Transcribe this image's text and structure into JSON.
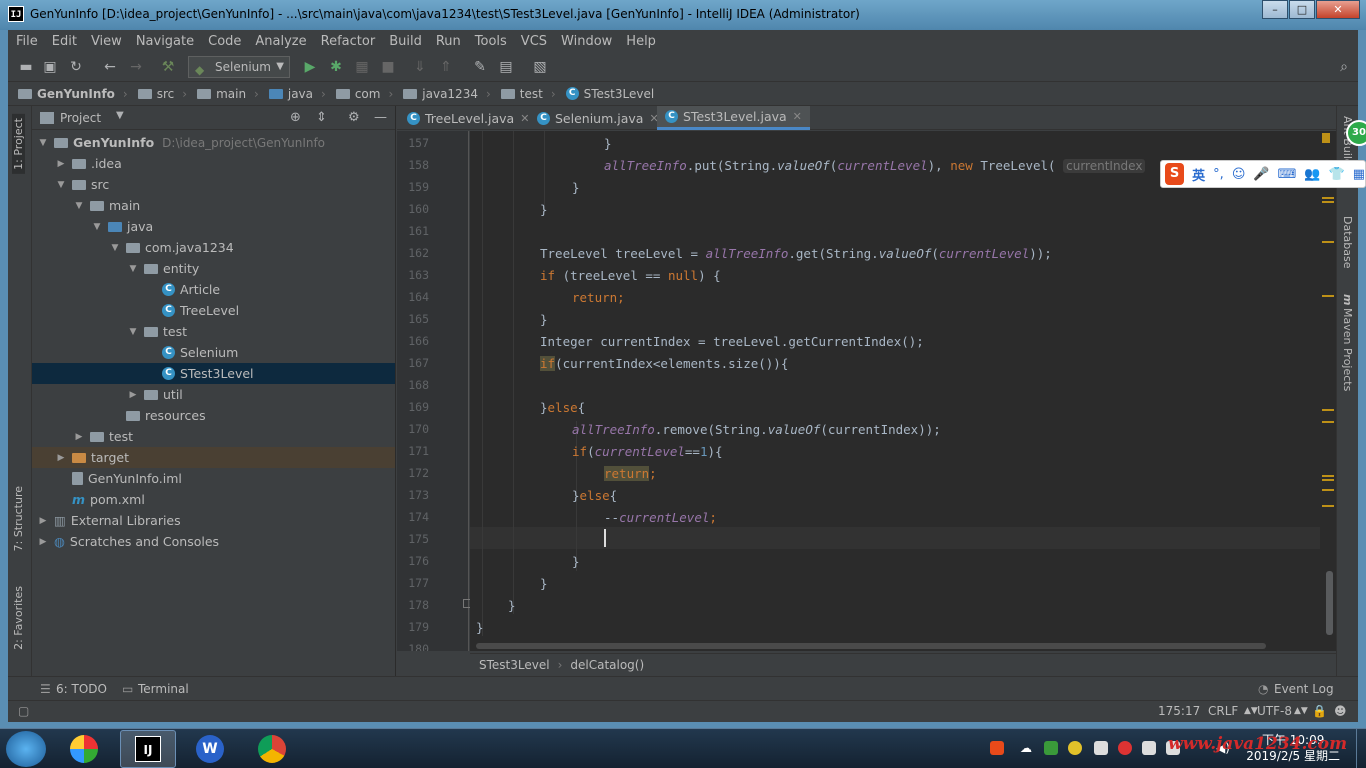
{
  "window": {
    "title": "GenYunInfo [D:\\idea_project\\GenYunInfo] - ...\\src\\main\\java\\com\\java1234\\test\\STest3Level.java [GenYunInfo] - IntelliJ IDEA (Administrator)",
    "app_icon": "IJ"
  },
  "menu": [
    "File",
    "Edit",
    "View",
    "Navigate",
    "Code",
    "Analyze",
    "Refactor",
    "Build",
    "Run",
    "Tools",
    "VCS",
    "Window",
    "Help"
  ],
  "toolbar": {
    "run_config": "Selenium"
  },
  "breadcrumbs": [
    "GenYunInfo",
    "src",
    "main",
    "java",
    "com",
    "java1234",
    "test",
    "STest3Level"
  ],
  "left_tabs": {
    "project": "1: Project",
    "structure": "7: Structure",
    "favorites": "2: Favorites"
  },
  "project_panel": {
    "title": "Project",
    "root": {
      "name": "GenYunInfo",
      "path": "D:\\idea_project\\GenYunInfo"
    },
    "tree": [
      {
        "label": ".idea"
      },
      {
        "label": "src"
      },
      {
        "label": "main"
      },
      {
        "label": "java"
      },
      {
        "label": "com.java1234"
      },
      {
        "label": "entity"
      },
      {
        "label": "Article"
      },
      {
        "label": "TreeLevel"
      },
      {
        "label": "test"
      },
      {
        "label": "Selenium"
      },
      {
        "label": "STest3Level"
      },
      {
        "label": "util"
      },
      {
        "label": "resources"
      },
      {
        "label": "test"
      },
      {
        "label": "target"
      },
      {
        "label": "GenYunInfo.iml"
      },
      {
        "label": "pom.xml"
      },
      {
        "label": "External Libraries"
      },
      {
        "label": "Scratches and Consoles"
      }
    ]
  },
  "editor": {
    "tabs": [
      "TreeLevel.java",
      "Selenium.java",
      "STest3Level.java"
    ],
    "active_tab": "STest3Level.java",
    "line_numbers": [
      "157",
      "158",
      "159",
      "160",
      "161",
      "162",
      "163",
      "164",
      "165",
      "166",
      "167",
      "168",
      "169",
      "170",
      "171",
      "172",
      "173",
      "174",
      "175",
      "176",
      "177",
      "178",
      "179",
      "180"
    ],
    "code": {
      "l157": "}",
      "l158_a": "allTreeInfo",
      "l158_b": ".put(String.",
      "l158_c": "valueOf",
      "l158_d": "(",
      "l158_e": "currentLevel",
      "l158_f": "), ",
      "l158_g": "new",
      "l158_h": " TreeLevel(",
      "l158_hint": "currentIndex",
      "l159": "}",
      "l160": "}",
      "l162_a": "TreeLevel treeLevel = ",
      "l162_b": "allTreeInfo",
      "l162_c": ".get(String.",
      "l162_d": "valueOf",
      "l162_e": "(",
      "l162_f": "currentLevel",
      "l162_g": "));",
      "l163_a": "if",
      "l163_b": " (treeLevel == ",
      "l163_c": "null",
      "l163_d": ") {",
      "l164": "return;",
      "l165": "}",
      "l166": "Integer currentIndex = treeLevel.getCurrentIndex();",
      "l167_a": "if",
      "l167_b": "(currentIndex<elements.size()){",
      "l169_a": "}",
      "l169_b": "else",
      "l169_c": "{",
      "l170_a": "allTreeInfo",
      "l170_b": ".remove(String.",
      "l170_c": "valueOf",
      "l170_d": "(currentIndex));",
      "l171_a": "if",
      "l171_b": "(",
      "l171_c": "currentLevel",
      "l171_d": "==",
      "l171_e": "1",
      "l171_f": "){",
      "l172_a": "return",
      "l172_b": ";",
      "l173_a": "}",
      "l173_b": "else",
      "l173_c": "{",
      "l174_a": "--",
      "l174_b": "currentLevel",
      "l174_c": ";",
      "l176": "}",
      "l177": "}",
      "l178": "}",
      "l179": "}"
    },
    "bottom_breadcrumb": [
      "STest3Level",
      "delCatalog()"
    ]
  },
  "right_tabs": {
    "ant": "Ant Build",
    "database": "Database",
    "maven": "Maven Projects"
  },
  "bottom_tools": {
    "todo": "6: TODO",
    "terminal": "Terminal",
    "event_log": "Event Log"
  },
  "status": {
    "position": "175:17",
    "line_sep": "CRLF",
    "encoding": "UTF-8"
  },
  "ime": {
    "logo": "S",
    "mode": "英"
  },
  "taskbar": {
    "apps": [
      "IJ",
      "W"
    ],
    "watermark": "www.java1234.com",
    "time": "下午 10:09",
    "date": "2019/2/5 星期二",
    "badge": "30"
  },
  "colors": {
    "accent": "#4a88c7",
    "keyword": "#cc7832",
    "field": "#9876aa",
    "number": "#6897bb",
    "selection": "#0d293e"
  }
}
